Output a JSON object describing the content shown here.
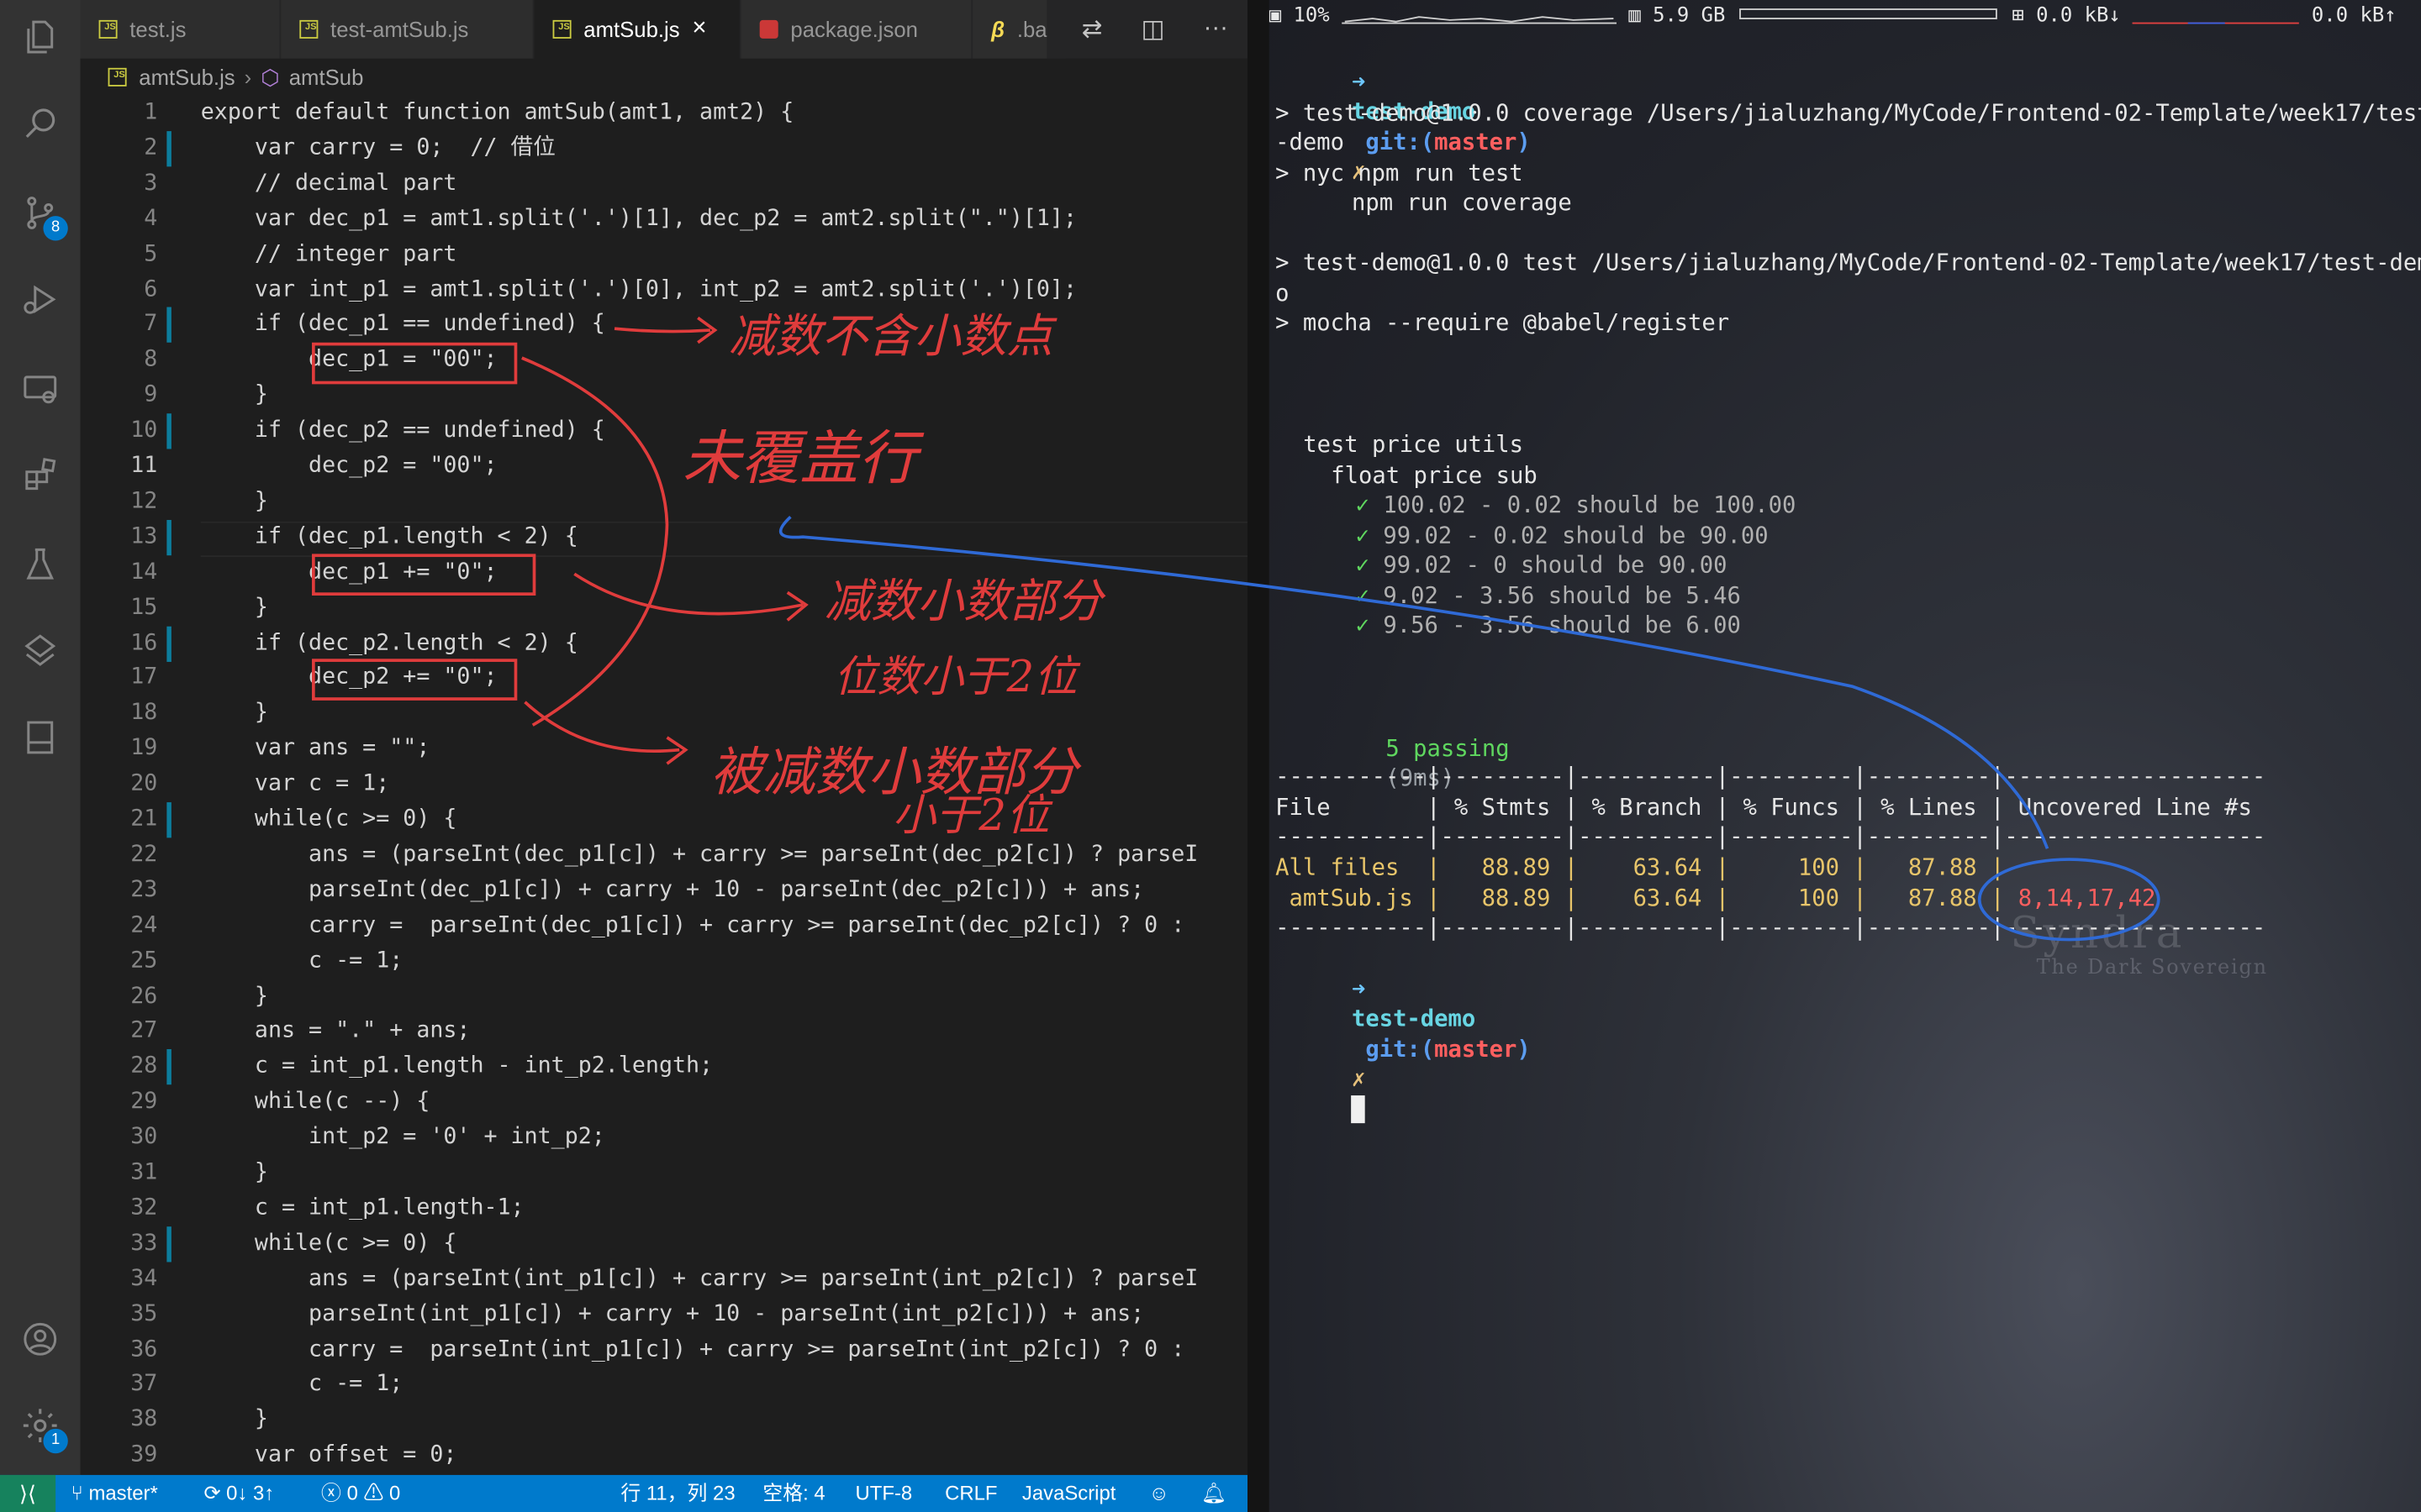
{
  "editor": {
    "tabs": [
      {
        "label": "test.js",
        "active": false
      },
      {
        "label": "test-amtSub.js",
        "active": false
      },
      {
        "label": "amtSub.js",
        "active": true
      },
      {
        "label": "package.json",
        "active": false
      },
      {
        "label": ".bal",
        "active": false
      }
    ],
    "tab_close_glyph": "×",
    "breadcrumb": {
      "file": "amtSub.js",
      "symbol": "amtSub"
    },
    "scm_badge": "8",
    "settings_badge": "1",
    "code_lines": [
      {
        "n": "1",
        "text": "export default function amtSub(amt1, amt2) {"
      },
      {
        "n": "2",
        "text": "    var carry = 0;  // 借位"
      },
      {
        "n": "3",
        "text": "    // decimal part"
      },
      {
        "n": "4",
        "text": "    var dec_p1 = amt1.split('.')[1], dec_p2 = amt2.split(\".\")[1];"
      },
      {
        "n": "5",
        "text": "    // integer part"
      },
      {
        "n": "6",
        "text": "    var int_p1 = amt1.split('.')[0], int_p2 = amt2.split('.')[0];"
      },
      {
        "n": "7",
        "text": "    if (dec_p1 == undefined) {"
      },
      {
        "n": "8",
        "text": "        dec_p1 = \"00\";"
      },
      {
        "n": "9",
        "text": "    }"
      },
      {
        "n": "10",
        "text": "    if (dec_p2 == undefined) {"
      },
      {
        "n": "11",
        "text": "        dec_p2 = \"00\";"
      },
      {
        "n": "12",
        "text": "    }"
      },
      {
        "n": "13",
        "text": "    if (dec_p1.length < 2) {"
      },
      {
        "n": "14",
        "text": "        dec_p1 += \"0\";"
      },
      {
        "n": "15",
        "text": "    }"
      },
      {
        "n": "16",
        "text": "    if (dec_p2.length < 2) {"
      },
      {
        "n": "17",
        "text": "        dec_p2 += \"0\";"
      },
      {
        "n": "18",
        "text": "    }"
      },
      {
        "n": "19",
        "text": "    var ans = \"\";"
      },
      {
        "n": "20",
        "text": "    var c = 1;"
      },
      {
        "n": "21",
        "text": "    while(c >= 0) {"
      },
      {
        "n": "22",
        "text": "        ans = (parseInt(dec_p1[c]) + carry >= parseInt(dec_p2[c]) ? parseI"
      },
      {
        "n": "23",
        "text": "        parseInt(dec_p1[c]) + carry + 10 - parseInt(dec_p2[c])) + ans;"
      },
      {
        "n": "24",
        "text": "        carry =  parseInt(dec_p1[c]) + carry >= parseInt(dec_p2[c]) ? 0 :"
      },
      {
        "n": "25",
        "text": "        c -= 1;"
      },
      {
        "n": "26",
        "text": "    }"
      },
      {
        "n": "27",
        "text": "    ans = \".\" + ans;"
      },
      {
        "n": "28",
        "text": "    c = int_p1.length - int_p2.length;"
      },
      {
        "n": "29",
        "text": "    while(c --) {"
      },
      {
        "n": "30",
        "text": "        int_p2 = '0' + int_p2;"
      },
      {
        "n": "31",
        "text": "    }"
      },
      {
        "n": "32",
        "text": "    c = int_p1.length-1;"
      },
      {
        "n": "33",
        "text": "    while(c >= 0) {"
      },
      {
        "n": "34",
        "text": "        ans = (parseInt(int_p1[c]) + carry >= parseInt(int_p2[c]) ? parseI"
      },
      {
        "n": "35",
        "text": "        parseInt(int_p1[c]) + carry + 10 - parseInt(int_p2[c])) + ans;"
      },
      {
        "n": "36",
        "text": "        carry =  parseInt(int_p1[c]) + carry >= parseInt(int_p2[c]) ? 0 :"
      },
      {
        "n": "37",
        "text": "        c -= 1;"
      },
      {
        "n": "38",
        "text": "    }"
      },
      {
        "n": "39",
        "text": "    var offset = 0;"
      }
    ],
    "statusbar": {
      "branch": "master*",
      "sync": "0↓ 3↑",
      "problems": "0",
      "warnings": "0",
      "position": "行 11，列 23",
      "spaces": "空格: 4",
      "encoding": "UTF-8",
      "eol": "CRLF",
      "language": "JavaScript"
    }
  },
  "annotations": {
    "note1": "减数不含小数点",
    "note2": "未覆盖行",
    "note3a": "减数小数部分",
    "note3b": "位数小于2位",
    "note4a": "被减数小数部分",
    "note4b": "小于2位"
  },
  "terminal": {
    "status": {
      "cpu": "10%",
      "mem": "5.9 GB",
      "net_down": "0.0 kB↓",
      "net_up": "0.0 kB↑"
    },
    "prompt_dir": "test-demo",
    "prompt_git": "git:(",
    "prompt_branch": "master",
    "prompt_git_close": ")",
    "prompt_x": "✗",
    "command": "npm run coverage",
    "out1": "> test-demo@1.0.0 coverage /Users/jialuzhang/MyCode/Frontend-02-Template/week17/test",
    "out2": "-demo",
    "out3": "> nyc npm run test",
    "out4": "> test-demo@1.0.0 test /Users/jialuzhang/MyCode/Frontend-02-Template/week17/test-dem",
    "out5": "o",
    "out6": "> mocha --require @babel/register",
    "suite": "test price utils",
    "subsuite": "float price sub",
    "check": "✓",
    "tests": [
      "100.02 - 0.02 should be 100.00",
      "99.02 - 0.02 should be 90.00",
      "99.02 - 0 should be 90.00",
      "9.02 - 3.56 should be 5.46",
      "9.56 - 3.56 should be 6.00"
    ],
    "passing": "5 passing",
    "passing_time": "(9ms)",
    "table": {
      "sep": "-----------|---------|----------|---------|---------|-------------------",
      "header": "File       | % Stmts | % Branch | % Funcs | % Lines | Uncovered Line #s",
      "row_all": "All files  |   88.89 |    63.64 |     100 |   87.88 |",
      "row_file_start": " amtSub.js |   88.89 |    63.64 |     100 |   87.88 | ",
      "uncovered": "8,14,17,42"
    },
    "watermark_title": "Syndra",
    "watermark_subtitle": "The Dark Sovereign"
  }
}
